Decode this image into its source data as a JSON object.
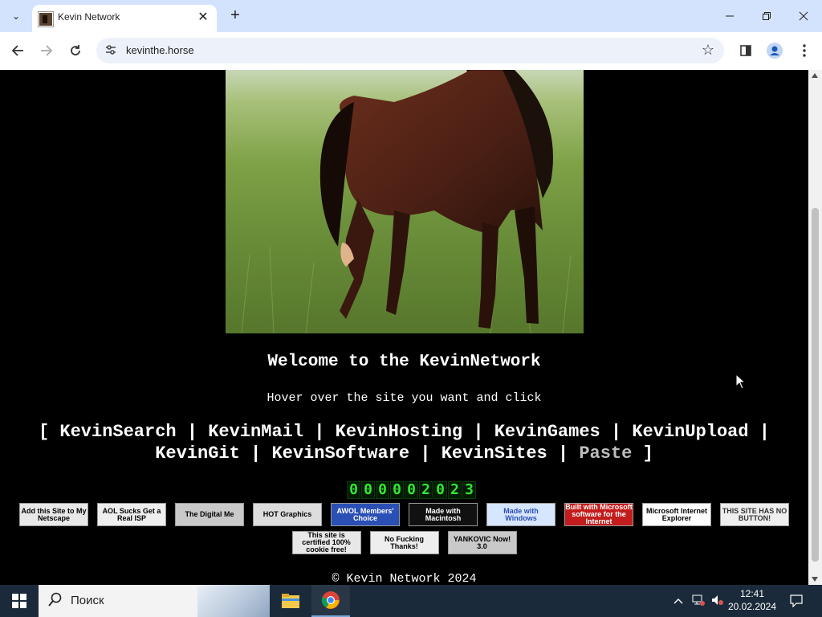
{
  "browser": {
    "tab": {
      "title": "Kevin Network"
    },
    "url": "kevinthe.horse"
  },
  "page": {
    "welcome": "Welcome to the KevinNetwork",
    "hover_text": "Hover over the site you want and click",
    "links_line1": [
      {
        "label": "KevinSearch"
      },
      {
        "label": "KevinMail"
      },
      {
        "label": "KevinHosting"
      },
      {
        "label": "KevinGames"
      },
      {
        "label": "KevinUpload"
      }
    ],
    "links_line2": [
      {
        "label": "KevinGit"
      },
      {
        "label": "KevinSoftware"
      },
      {
        "label": "KevinSites"
      },
      {
        "label": "Paste"
      }
    ],
    "bracket_open": "[",
    "bracket_close": "]",
    "separator": "|",
    "counter": "000002023",
    "badges_row1": [
      "Add this Site to My Netscape",
      "AOL Sucks Get a Real ISP",
      "The Digital Me",
      "HOT Graphics",
      "AWOL Members' Choice",
      "Made with Macintosh",
      "Made with Windows",
      "Built with Microsoft software for the Internet",
      "Microsoft Internet Explorer",
      "THIS SITE HAS NO BUTTON!"
    ],
    "badges_row2": [
      "This site is certified 100% cookie free!",
      "No Fucking Thanks!",
      "YANKOVIC Now! 3.0"
    ],
    "footer": "© Kevin Network 2024"
  },
  "taskbar": {
    "search_placeholder": "Поиск",
    "time": "12:41",
    "date": "20.02.2024"
  }
}
